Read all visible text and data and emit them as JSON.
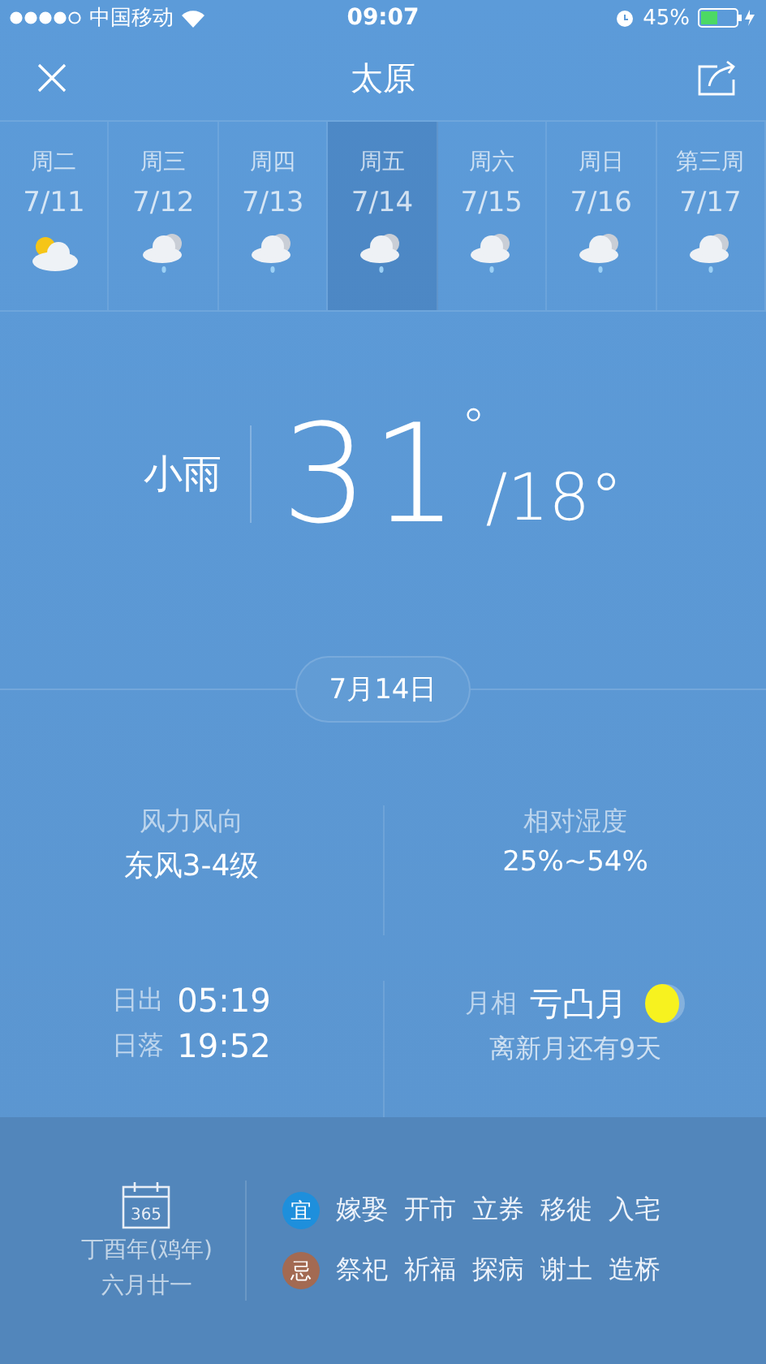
{
  "status_bar": {
    "carrier": "中国移动",
    "time": "09:07",
    "battery": "45%"
  },
  "header": {
    "title": "太原"
  },
  "days": [
    {
      "weekday": "周二",
      "date": "7/11",
      "kind": "sun_cloud",
      "selected": false
    },
    {
      "weekday": "周三",
      "date": "7/12",
      "kind": "rain",
      "selected": false
    },
    {
      "weekday": "周四",
      "date": "7/13",
      "kind": "rain",
      "selected": false
    },
    {
      "weekday": "周五",
      "date": "7/14",
      "kind": "rain",
      "selected": true
    },
    {
      "weekday": "周六",
      "date": "7/15",
      "kind": "rain",
      "selected": false
    },
    {
      "weekday": "周日",
      "date": "7/16",
      "kind": "rain",
      "selected": false
    },
    {
      "weekday": "第三周",
      "date": "7/17",
      "kind": "rain",
      "selected": false
    }
  ],
  "today": {
    "condition": "小雨",
    "high": "31",
    "high_unit": "°",
    "low": "/18°",
    "date": "7月14日"
  },
  "details": {
    "wind_label": "风力风向",
    "wind_value": "东风3-4级",
    "humidity_label": "相对湿度",
    "humidity_value": "25%~54%",
    "sunrise_label": "日出",
    "sunrise": "05:19",
    "sunset_label": "日落",
    "sunset": "19:52",
    "moon_label": "月相",
    "moon_phase": "亏凸月",
    "moon_note": "离新月还有9天"
  },
  "almanac": {
    "calendar_number": "365",
    "year": "丁酉年(鸡年)",
    "lunar_date": "六月廿一",
    "rows": [
      {
        "badge": "宜",
        "color": "#1e8fdc",
        "items": [
          "嫁娶",
          "开市",
          "立券",
          "移徙",
          "入宅"
        ]
      },
      {
        "badge": "忌",
        "color": "#a36a52",
        "items": [
          "祭祀",
          "祈福",
          "探病",
          "谢土",
          "造桥"
        ]
      }
    ]
  }
}
